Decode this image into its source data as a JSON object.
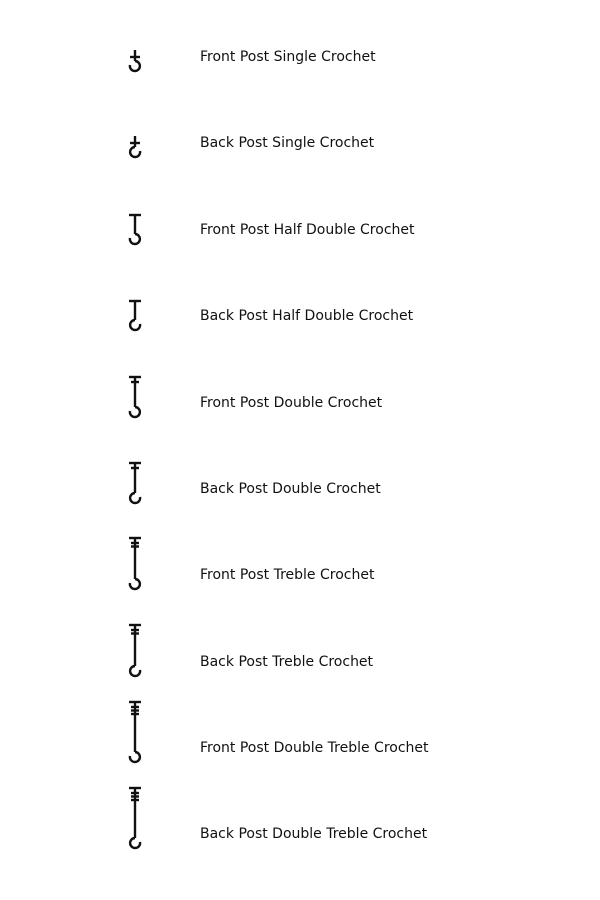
{
  "stitches": [
    {
      "label": "Front Post Single Crochet",
      "icon": "front-post-single-crochet-icon",
      "post": "front",
      "kind": "sc"
    },
    {
      "label": "Back Post Single Crochet",
      "icon": "back-post-single-crochet-icon",
      "post": "back",
      "kind": "sc"
    },
    {
      "label": "Front Post Half Double Crochet",
      "icon": "front-post-half-double-crochet-icon",
      "post": "front",
      "kind": "hdc"
    },
    {
      "label": "Back Post Half Double Crochet",
      "icon": "back-post-half-double-crochet-icon",
      "post": "back",
      "kind": "hdc"
    },
    {
      "label": "Front Post Double Crochet",
      "icon": "front-post-double-crochet-icon",
      "post": "front",
      "kind": "dc"
    },
    {
      "label": "Back Post Double Crochet",
      "icon": "back-post-double-crochet-icon",
      "post": "back",
      "kind": "dc"
    },
    {
      "label": "Front Post Treble Crochet",
      "icon": "front-post-treble-crochet-icon",
      "post": "front",
      "kind": "tr"
    },
    {
      "label": "Back Post Treble Crochet",
      "icon": "back-post-treble-crochet-icon",
      "post": "back",
      "kind": "tr"
    },
    {
      "label": "Front Post Double Treble Crochet",
      "icon": "front-post-double-treble-crochet-icon",
      "post": "front",
      "kind": "dtr"
    },
    {
      "label": "Back Post Double Treble Crochet",
      "icon": "back-post-double-treble-crochet-icon",
      "post": "back",
      "kind": "dtr"
    }
  ],
  "colors": {
    "ink": "#111111",
    "background": "#ffffff"
  }
}
